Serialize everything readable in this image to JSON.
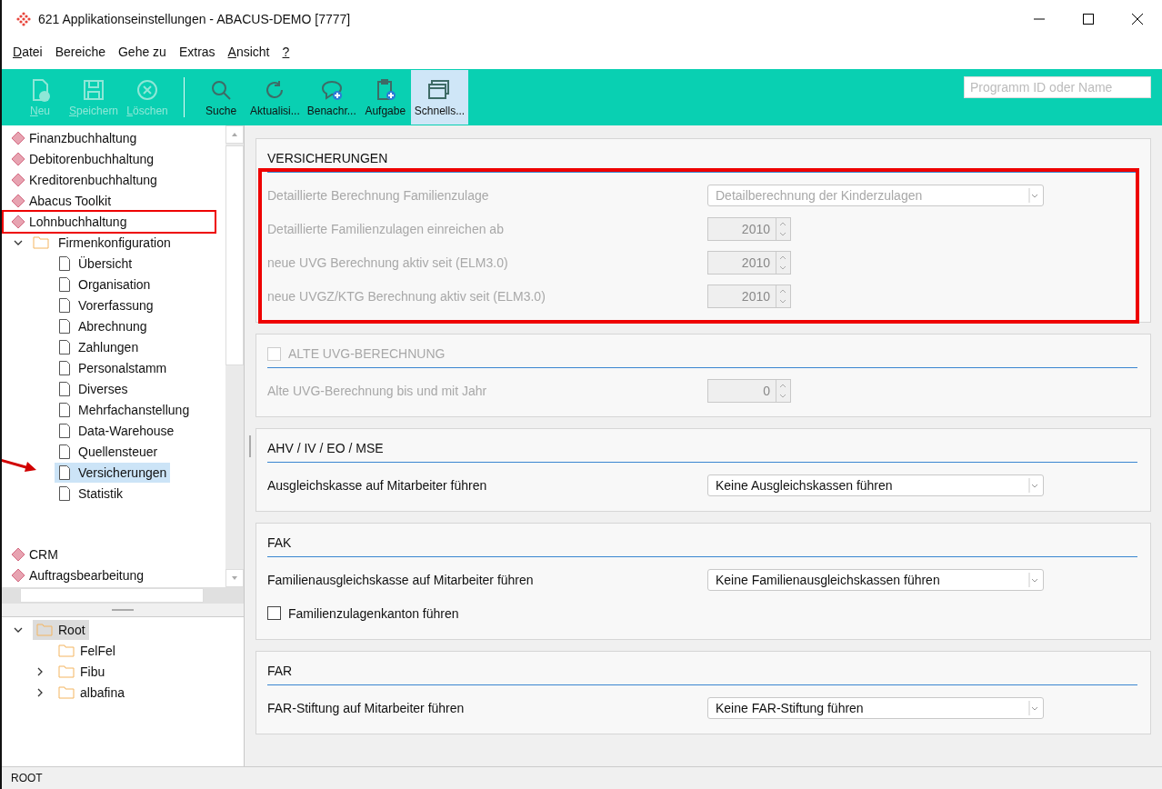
{
  "window": {
    "title": "621 Applikationseinstellungen - ABACUS-DEMO [7777]"
  },
  "menu": [
    {
      "accel": "D",
      "label": "atei"
    },
    {
      "label": "Bereiche"
    },
    {
      "label": "Gehe zu"
    },
    {
      "label": "Extras"
    },
    {
      "accel": "A",
      "label": "nsicht"
    },
    {
      "accel": "?"
    }
  ],
  "toolbar": {
    "groups": [
      [
        {
          "kind": "new",
          "accel": "N",
          "label": "eu",
          "disabled": true,
          "selected": false
        },
        {
          "kind": "save",
          "accel": "S",
          "label": "peichern",
          "disabled": true,
          "selected": false
        },
        {
          "kind": "delete",
          "accel": "L",
          "label": "öschen",
          "disabled": true,
          "selected": false
        }
      ],
      [
        {
          "kind": "search",
          "label": "Suche",
          "disabled": false,
          "selected": false
        },
        {
          "kind": "refresh",
          "label": "Aktualisi...",
          "disabled": false,
          "selected": false
        },
        {
          "kind": "message",
          "label": "Benachr...",
          "disabled": false,
          "selected": false
        },
        {
          "kind": "task",
          "label": "Aufgabe",
          "disabled": false,
          "selected": false
        },
        {
          "kind": "windows",
          "label": "Schnells...",
          "disabled": false,
          "selected": true
        }
      ]
    ],
    "search": {
      "placeholder": "Programm ID oder Name"
    }
  },
  "nav": {
    "modules": [
      {
        "label": "Finanzbuchhaltung",
        "highlighted": false
      },
      {
        "label": "Debitorenbuchhaltung",
        "highlighted": false
      },
      {
        "label": "Kreditorenbuchhaltung",
        "highlighted": false
      },
      {
        "label": "Abacus Toolkit",
        "highlighted": false
      },
      {
        "label": "Lohnbuchhaltung",
        "highlighted": true,
        "children": [
          {
            "label": "Firmenkonfiguration",
            "expanded": true,
            "children": [
              {
                "label": "Übersicht",
                "selected": false,
                "arrow": false
              },
              {
                "label": "Organisation",
                "selected": false,
                "arrow": false
              },
              {
                "label": "Vorerfassung",
                "selected": false,
                "arrow": false
              },
              {
                "label": "Abrechnung",
                "selected": false,
                "arrow": false
              },
              {
                "label": "Zahlungen",
                "selected": false,
                "arrow": false
              },
              {
                "label": "Personalstamm",
                "selected": false,
                "arrow": false
              },
              {
                "label": "Diverses",
                "selected": false,
                "arrow": false
              },
              {
                "label": "Mehrfachanstellung",
                "selected": false,
                "arrow": false
              },
              {
                "label": "Data-Warehouse",
                "selected": false,
                "arrow": false
              },
              {
                "label": "Quellensteuer",
                "selected": false,
                "arrow": false
              },
              {
                "label": "Versicherungen",
                "selected": true,
                "arrow": true
              },
              {
                "label": "Statistik",
                "selected": false,
                "arrow": false
              }
            ]
          }
        ]
      },
      {
        "label": "CRM",
        "highlighted": false
      },
      {
        "label": "Auftragsbearbeitung",
        "highlighted": false
      }
    ]
  },
  "folders": [
    {
      "label": "Root",
      "expanded": true,
      "selected": true,
      "children": [
        {
          "label": "FelFel",
          "selected": false,
          "has_children": false
        },
        {
          "label": "Fibu",
          "selected": false,
          "has_children": true
        },
        {
          "label": "albafina",
          "selected": false,
          "has_children": true
        }
      ]
    }
  ],
  "status_bar": "ROOT",
  "sections": [
    {
      "title": "VERSICHERUNGEN",
      "kind": "heading",
      "highlighted": true,
      "rows": [
        {
          "kind": "select",
          "label": "Detaillierte Berechnung Familienzulage",
          "value": "Detailberechnung der Kinderzulagen",
          "disabled": true
        },
        {
          "kind": "spinner",
          "label": "Detaillierte Familienzulagen einreichen ab",
          "value": "2010",
          "disabled": true
        },
        {
          "kind": "spinner",
          "label": "neue UVG Berechnung aktiv seit (ELM3.0)",
          "value": "2010",
          "disabled": true
        },
        {
          "kind": "spinner",
          "label": "neue UVGZ/KTG Berechnung aktiv seit (ELM3.0)",
          "value": "2010",
          "disabled": true
        }
      ]
    },
    {
      "title": "ALTE UVG-BERECHNUNG",
      "kind": "checkbox",
      "checked": false,
      "disabled": true,
      "highlighted": false,
      "rows": [
        {
          "kind": "spinner",
          "label": "Alte UVG-Berechnung bis und mit Jahr",
          "value": "0",
          "disabled": true
        }
      ]
    },
    {
      "title": "AHV / IV / EO / MSE",
      "kind": "heading",
      "highlighted": false,
      "rows": [
        {
          "kind": "select",
          "label": "Ausgleichskasse auf Mitarbeiter führen",
          "value": "Keine Ausgleichskassen führen",
          "disabled": false
        }
      ]
    },
    {
      "title": "FAK",
      "kind": "heading",
      "highlighted": false,
      "rows": [
        {
          "kind": "select",
          "label": "Familienausgleichskasse auf Mitarbeiter führen",
          "value": "Keine Familienausgleichskassen führen",
          "disabled": false
        },
        {
          "kind": "checkbox",
          "label": "Familienzulagenkanton führen",
          "checked": false,
          "disabled": false
        }
      ]
    },
    {
      "title": "FAR",
      "kind": "heading",
      "highlighted": false,
      "rows": [
        {
          "kind": "select",
          "label": "FAR-Stiftung auf Mitarbeiter führen",
          "value": "Keine FAR-Stiftung führen",
          "disabled": false
        }
      ]
    }
  ]
}
